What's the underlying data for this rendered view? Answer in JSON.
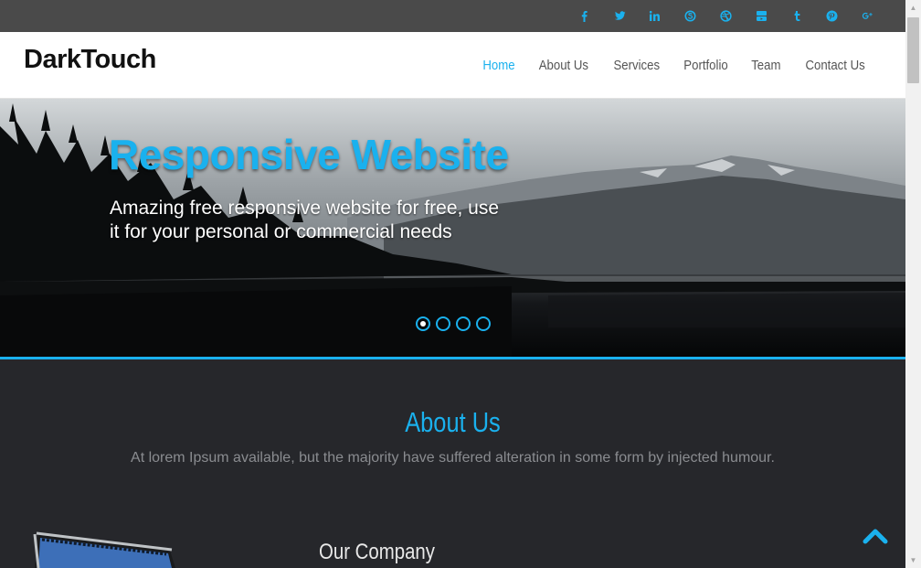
{
  "social": [
    {
      "name": "facebook-icon",
      "glyph": "f"
    },
    {
      "name": "twitter-icon",
      "glyph": "t"
    },
    {
      "name": "linkedin-icon",
      "glyph": "in"
    },
    {
      "name": "skype-icon",
      "glyph": "S"
    },
    {
      "name": "dribbble-icon",
      "glyph": "◎"
    },
    {
      "name": "youtube-icon",
      "glyph": "You"
    },
    {
      "name": "tumblr-icon",
      "glyph": "t"
    },
    {
      "name": "pinterest-icon",
      "glyph": "p"
    },
    {
      "name": "google-plus-icon",
      "glyph": "g+"
    }
  ],
  "brand": "DarkTouch",
  "nav": {
    "home": "Home",
    "about": "About Us",
    "services": "Services",
    "portfolio": "Portfolio",
    "team": "Team",
    "contact": "Contact Us"
  },
  "hero": {
    "title": "Responsive Website",
    "subtitle": "Amazing free responsive website for free, use it for your personal or commercial needs",
    "slides": 4,
    "active_slide": 1
  },
  "about": {
    "title": "About Us",
    "text": "At lorem Ipsum available, but the majority have suffered alteration in some form by injected humour."
  },
  "company": {
    "title": "Our Company"
  },
  "colors": {
    "accent": "#1ab1ee",
    "background": "#26272b",
    "topbar": "#4a4a4a"
  }
}
